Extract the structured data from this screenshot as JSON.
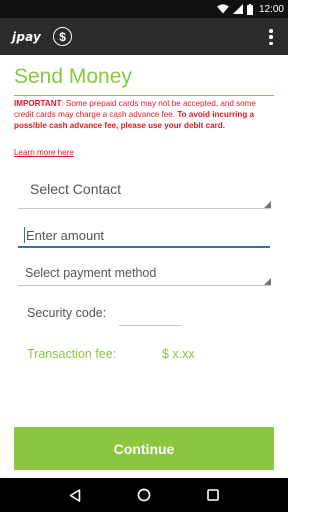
{
  "status_bar": {
    "time": "12:00",
    "icons": [
      "wifi-icon",
      "cell-signal-icon",
      "battery-icon"
    ]
  },
  "app_bar": {
    "logo_text": "jpay",
    "icons": [
      "dollar-circle-icon",
      "overflow-menu-icon"
    ]
  },
  "page": {
    "title": "Send Money",
    "notice_prefix": "IMPORTANT",
    "notice_body": ": Some prepaid cards may not be accepted, and some credit cards may charge a cash advance fee. ",
    "notice_emphasis": "To avoid incurring a possible cash advance fee, please use your debit card.",
    "learn_more": "Learn more here"
  },
  "form": {
    "contact_select": "Select Contact",
    "amount_placeholder": "Enter amount",
    "payment_select": "Select payment method",
    "security_code_label": "Security code:",
    "security_code_value": "",
    "transaction_fee_label": "Transaction fee:",
    "transaction_fee_value": "$ x.xx"
  },
  "actions": {
    "continue": "Continue"
  },
  "nav_bar": {
    "icons": [
      "back-icon",
      "home-icon",
      "recents-icon"
    ]
  },
  "colors": {
    "accent_green": "#8cc63f",
    "warning_red": "#e11b22",
    "input_focus_blue": "#2a77a7",
    "app_bar": "#2b2b2b",
    "status_bar": "#111111"
  }
}
